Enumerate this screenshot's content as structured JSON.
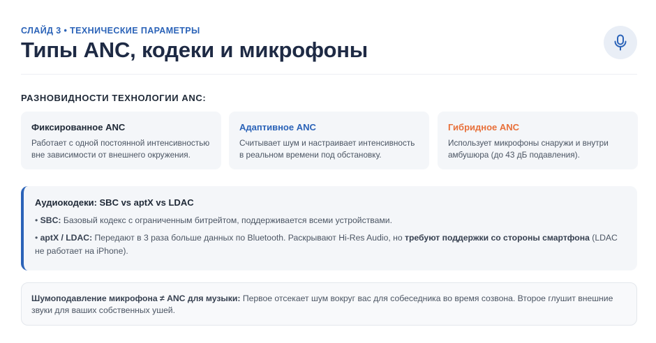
{
  "header": {
    "kicker": "СЛАЙД 3 • ТЕХНИЧЕСКИЕ ПАРАМЕТРЫ",
    "title": "Типы ANC, кодеки и микрофоны",
    "icon": "microphone-icon"
  },
  "section": {
    "label": "РАЗНОВИДНОСТИ ТЕХНОЛОГИИ ANC:"
  },
  "cards": [
    {
      "title": "Фиксированное ANC",
      "text": "Работает с одной постоянной интенсивностью вне зависимости от внешнего окружения.",
      "color": "#1f2937"
    },
    {
      "title": "Адаптивное ANC",
      "text": "Считывает шум и настраивает интенсивность в реальном времени под обстановку.",
      "color": "#2b63b8"
    },
    {
      "title": "Гибридное ANC",
      "text": "Использует микрофоны снаружи и внутри амбушюра (до 43 дБ подавления).",
      "color": "#e8703a"
    }
  ],
  "codecs": {
    "title": "Аудиокодеки: SBC vs aptX vs LDAC",
    "items": [
      {
        "bullet": "• ",
        "name": "SBC:",
        "text": " Базовый кодекс с ограниченным битрейтом, поддерживается всеми устройствами."
      },
      {
        "bullet": "• ",
        "name": "aptX / LDAC:",
        "text": " Передают в 3 раза больше данных по Bluetooth. Раскрывают Hi-Res Audio, но ",
        "emphasis": "требуют поддержки со стороны смартфона",
        "tail": " (LDAC не работает на iPhone)."
      }
    ]
  },
  "note": {
    "lead": "Шумоподавление микрофона ≠ ANC для музыки:",
    "text": " Первое отсекает шум вокруг вас для собеседника во время созвона. Второе глушит внешние звуки для ваших собственных ушей."
  },
  "colors": {
    "accent": "#2b63b8",
    "orange": "#e8703a",
    "title": "#1e2a44"
  }
}
